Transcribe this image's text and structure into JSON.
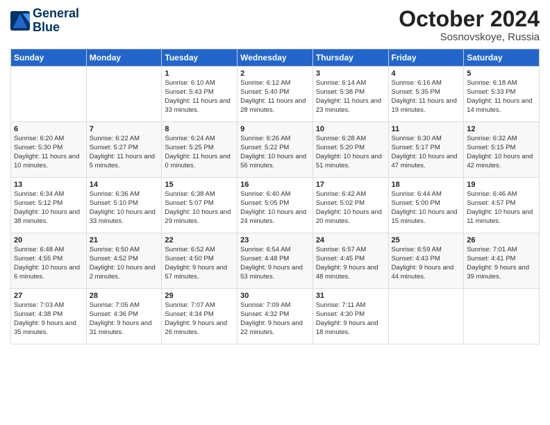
{
  "logo": {
    "line1": "General",
    "line2": "Blue"
  },
  "title": "October 2024",
  "location": "Sosnovskoye, Russia",
  "days_of_week": [
    "Sunday",
    "Monday",
    "Tuesday",
    "Wednesday",
    "Thursday",
    "Friday",
    "Saturday"
  ],
  "weeks": [
    [
      {
        "day": "",
        "sunrise": "",
        "sunset": "",
        "daylight": ""
      },
      {
        "day": "",
        "sunrise": "",
        "sunset": "",
        "daylight": ""
      },
      {
        "day": "1",
        "sunrise": "Sunrise: 6:10 AM",
        "sunset": "Sunset: 5:43 PM",
        "daylight": "Daylight: 11 hours and 33 minutes."
      },
      {
        "day": "2",
        "sunrise": "Sunrise: 6:12 AM",
        "sunset": "Sunset: 5:40 PM",
        "daylight": "Daylight: 11 hours and 28 minutes."
      },
      {
        "day": "3",
        "sunrise": "Sunrise: 6:14 AM",
        "sunset": "Sunset: 5:38 PM",
        "daylight": "Daylight: 11 hours and 23 minutes."
      },
      {
        "day": "4",
        "sunrise": "Sunrise: 6:16 AM",
        "sunset": "Sunset: 5:35 PM",
        "daylight": "Daylight: 11 hours and 19 minutes."
      },
      {
        "day": "5",
        "sunrise": "Sunrise: 6:18 AM",
        "sunset": "Sunset: 5:33 PM",
        "daylight": "Daylight: 11 hours and 14 minutes."
      }
    ],
    [
      {
        "day": "6",
        "sunrise": "Sunrise: 6:20 AM",
        "sunset": "Sunset: 5:30 PM",
        "daylight": "Daylight: 11 hours and 10 minutes."
      },
      {
        "day": "7",
        "sunrise": "Sunrise: 6:22 AM",
        "sunset": "Sunset: 5:27 PM",
        "daylight": "Daylight: 11 hours and 5 minutes."
      },
      {
        "day": "8",
        "sunrise": "Sunrise: 6:24 AM",
        "sunset": "Sunset: 5:25 PM",
        "daylight": "Daylight: 11 hours and 0 minutes."
      },
      {
        "day": "9",
        "sunrise": "Sunrise: 6:26 AM",
        "sunset": "Sunset: 5:22 PM",
        "daylight": "Daylight: 10 hours and 56 minutes."
      },
      {
        "day": "10",
        "sunrise": "Sunrise: 6:28 AM",
        "sunset": "Sunset: 5:20 PM",
        "daylight": "Daylight: 10 hours and 51 minutes."
      },
      {
        "day": "11",
        "sunrise": "Sunrise: 6:30 AM",
        "sunset": "Sunset: 5:17 PM",
        "daylight": "Daylight: 10 hours and 47 minutes."
      },
      {
        "day": "12",
        "sunrise": "Sunrise: 6:32 AM",
        "sunset": "Sunset: 5:15 PM",
        "daylight": "Daylight: 10 hours and 42 minutes."
      }
    ],
    [
      {
        "day": "13",
        "sunrise": "Sunrise: 6:34 AM",
        "sunset": "Sunset: 5:12 PM",
        "daylight": "Daylight: 10 hours and 38 minutes."
      },
      {
        "day": "14",
        "sunrise": "Sunrise: 6:36 AM",
        "sunset": "Sunset: 5:10 PM",
        "daylight": "Daylight: 10 hours and 33 minutes."
      },
      {
        "day": "15",
        "sunrise": "Sunrise: 6:38 AM",
        "sunset": "Sunset: 5:07 PM",
        "daylight": "Daylight: 10 hours and 29 minutes."
      },
      {
        "day": "16",
        "sunrise": "Sunrise: 6:40 AM",
        "sunset": "Sunset: 5:05 PM",
        "daylight": "Daylight: 10 hours and 24 minutes."
      },
      {
        "day": "17",
        "sunrise": "Sunrise: 6:42 AM",
        "sunset": "Sunset: 5:02 PM",
        "daylight": "Daylight: 10 hours and 20 minutes."
      },
      {
        "day": "18",
        "sunrise": "Sunrise: 6:44 AM",
        "sunset": "Sunset: 5:00 PM",
        "daylight": "Daylight: 10 hours and 15 minutes."
      },
      {
        "day": "19",
        "sunrise": "Sunrise: 6:46 AM",
        "sunset": "Sunset: 4:57 PM",
        "daylight": "Daylight: 10 hours and 11 minutes."
      }
    ],
    [
      {
        "day": "20",
        "sunrise": "Sunrise: 6:48 AM",
        "sunset": "Sunset: 4:55 PM",
        "daylight": "Daylight: 10 hours and 6 minutes."
      },
      {
        "day": "21",
        "sunrise": "Sunrise: 6:50 AM",
        "sunset": "Sunset: 4:52 PM",
        "daylight": "Daylight: 10 hours and 2 minutes."
      },
      {
        "day": "22",
        "sunrise": "Sunrise: 6:52 AM",
        "sunset": "Sunset: 4:50 PM",
        "daylight": "Daylight: 9 hours and 57 minutes."
      },
      {
        "day": "23",
        "sunrise": "Sunrise: 6:54 AM",
        "sunset": "Sunset: 4:48 PM",
        "daylight": "Daylight: 9 hours and 53 minutes."
      },
      {
        "day": "24",
        "sunrise": "Sunrise: 6:57 AM",
        "sunset": "Sunset: 4:45 PM",
        "daylight": "Daylight: 9 hours and 48 minutes."
      },
      {
        "day": "25",
        "sunrise": "Sunrise: 6:59 AM",
        "sunset": "Sunset: 4:43 PM",
        "daylight": "Daylight: 9 hours and 44 minutes."
      },
      {
        "day": "26",
        "sunrise": "Sunrise: 7:01 AM",
        "sunset": "Sunset: 4:41 PM",
        "daylight": "Daylight: 9 hours and 39 minutes."
      }
    ],
    [
      {
        "day": "27",
        "sunrise": "Sunrise: 7:03 AM",
        "sunset": "Sunset: 4:38 PM",
        "daylight": "Daylight: 9 hours and 35 minutes."
      },
      {
        "day": "28",
        "sunrise": "Sunrise: 7:05 AM",
        "sunset": "Sunset: 4:36 PM",
        "daylight": "Daylight: 9 hours and 31 minutes."
      },
      {
        "day": "29",
        "sunrise": "Sunrise: 7:07 AM",
        "sunset": "Sunset: 4:34 PM",
        "daylight": "Daylight: 9 hours and 26 minutes."
      },
      {
        "day": "30",
        "sunrise": "Sunrise: 7:09 AM",
        "sunset": "Sunset: 4:32 PM",
        "daylight": "Daylight: 9 hours and 22 minutes."
      },
      {
        "day": "31",
        "sunrise": "Sunrise: 7:11 AM",
        "sunset": "Sunset: 4:30 PM",
        "daylight": "Daylight: 9 hours and 18 minutes."
      },
      {
        "day": "",
        "sunrise": "",
        "sunset": "",
        "daylight": ""
      },
      {
        "day": "",
        "sunrise": "",
        "sunset": "",
        "daylight": ""
      }
    ]
  ]
}
